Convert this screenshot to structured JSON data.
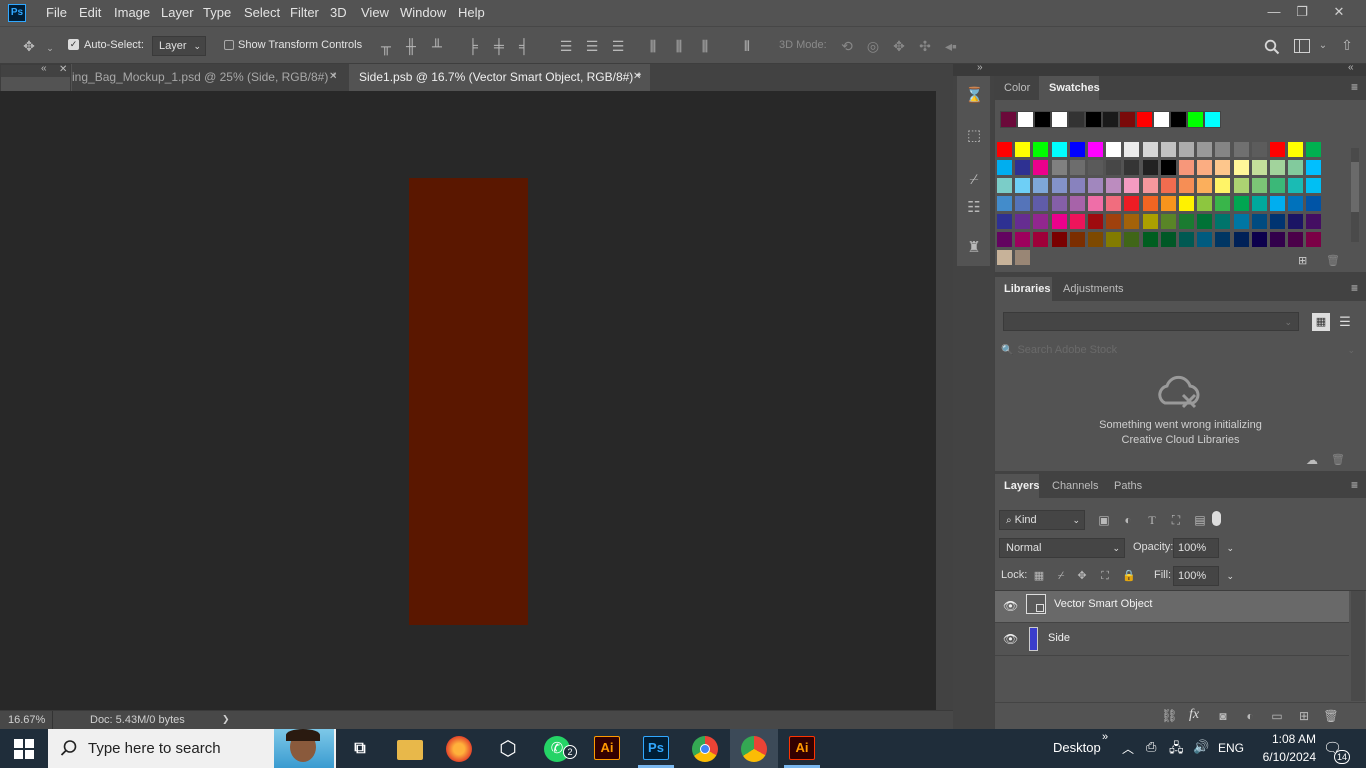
{
  "app": {
    "logo": "Ps"
  },
  "menu": [
    "File",
    "Edit",
    "Image",
    "Layer",
    "Type",
    "Select",
    "Filter",
    "3D",
    "View",
    "Window",
    "Help"
  ],
  "window_controls": {
    "minimize": "—",
    "restore": "❐",
    "close": "✕"
  },
  "options": {
    "auto_select_label": "Auto-Select:",
    "auto_select_value": "Layer",
    "show_transform_label": "Show Transform Controls",
    "mode_3d_label": "3D Mode:"
  },
  "tabs": [
    {
      "label": "ing_Bag_Mockup_1.psd @ 25% (Side, RGB/8#) *",
      "close": "✕",
      "active": false
    },
    {
      "label": "Side1.psb @ 16.7% (Vector Smart Object, RGB/8#) *",
      "close": "✕",
      "active": true
    }
  ],
  "tools": {
    "more": "•••",
    "foreground_color": "#7a0a3e",
    "background_color": "#ffffff"
  },
  "status": {
    "zoom": "16.67%",
    "doc": "Doc: 5.43M/0 bytes",
    "arrow": "❯"
  },
  "canvas": {
    "artwork_color": "#5a1700"
  },
  "swatches_panel": {
    "tabs": [
      "Color",
      "Swatches"
    ],
    "recent": [
      "#6b0a3a",
      "#ffffff",
      "#000000",
      "#ffffff",
      "#333333",
      "#000000",
      "#1a1a1a",
      "#7a0a0a",
      "#ff0000",
      "#ffffff",
      "#000000",
      "#00ff00",
      "#00ffff"
    ],
    "rows": [
      [
        "#ff0000",
        "#ffff00",
        "#00ff00",
        "#00ffff",
        "#0000ff",
        "#ff00ff",
        "#ffffff",
        "#ebebeb",
        "#d6d6d6",
        "#c2c2c2",
        "#adadad",
        "#999999",
        "#858585",
        "#707070",
        "#5c5c5c",
        "#ff0000",
        "#ffff00",
        "#00b050"
      ],
      [
        "#00aeef",
        "#2e3192",
        "#ec008c",
        "#808080",
        "#6d6d6d",
        "#5a5a5a",
        "#474747",
        "#353535",
        "#222222",
        "#000000",
        "#f7977a",
        "#fbad82",
        "#fdc68c",
        "#fff799",
        "#c4df9b",
        "#a2d39c",
        "#82ca9d",
        "#00bfff"
      ],
      [
        "#7bcdc8",
        "#6ecff6",
        "#7ea7d8",
        "#8493ca",
        "#8882be",
        "#a187be",
        "#bc8cbf",
        "#f49bc1",
        "#f5989d",
        "#f26c4f",
        "#f68e55",
        "#fbaf5c",
        "#fff467",
        "#acd372",
        "#7cc576",
        "#3bb878",
        "#1abbb4",
        "#00bff3"
      ],
      [
        "#438ccb",
        "#5574b9",
        "#605ca9",
        "#855fa8",
        "#a763a9",
        "#ef6ea8",
        "#f16d7e",
        "#ed1c24",
        "#f26522",
        "#f7941d",
        "#fff200",
        "#8dc63f",
        "#39b54a",
        "#00a651",
        "#00a99d",
        "#00aeef",
        "#0072bc",
        "#0054a6"
      ],
      [
        "#2e3192",
        "#662d91",
        "#92278f",
        "#ec008c",
        "#ed145b",
        "#9e0b0f",
        "#a0410d",
        "#a36209",
        "#aba000",
        "#598527",
        "#1a7b30",
        "#007236",
        "#00746b",
        "#0076a3",
        "#004b80",
        "#003471",
        "#1b1464",
        "#440e62"
      ],
      [
        "#630460",
        "#9e005d",
        "#9e0039",
        "#790000",
        "#7b2e00",
        "#7d4900",
        "#827b00",
        "#406618",
        "#005e20",
        "#005826",
        "#005952",
        "#005b7f",
        "#003663",
        "#002157",
        "#0d004c",
        "#32004b",
        "#4b0049",
        "#7b0046"
      ],
      [
        "#c7b299",
        "#998675"
      ]
    ]
  },
  "libraries_panel": {
    "tabs": [
      "Libraries",
      "Adjustments"
    ],
    "search_placeholder": "Search Adobe Stock",
    "error_line1": "Something went wrong initializing",
    "error_line2": "Creative Cloud Libraries"
  },
  "layers_panel": {
    "tabs": [
      "Layers",
      "Channels",
      "Paths"
    ],
    "filter_kind": "Kind",
    "blend_mode": "Normal",
    "opacity_label": "Opacity:",
    "opacity_value": "100%",
    "lock_label": "Lock:",
    "fill_label": "Fill:",
    "fill_value": "100%",
    "layers": [
      {
        "name": "Vector Smart Object",
        "selected": true
      },
      {
        "name": "Side",
        "selected": false
      }
    ],
    "footer_fx": "fx"
  },
  "taskbar": {
    "search_placeholder": "Type here to search",
    "whatsapp_badge": "2",
    "illustrator_label": "Ai",
    "photoshop_label": "Ps",
    "desktop_label": "Desktop",
    "language": "ENG",
    "time": "1:08 AM",
    "date": "6/10/2024",
    "notification_count": "14"
  }
}
